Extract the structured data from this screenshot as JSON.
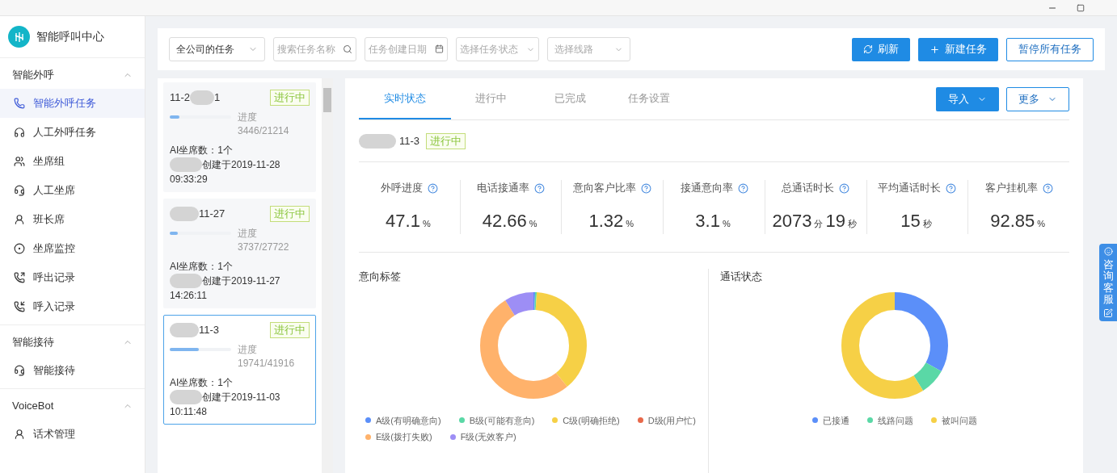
{
  "app": {
    "title": "智能呼叫中心"
  },
  "sidebar": {
    "groups": [
      {
        "label": "智能外呼",
        "expanded": true,
        "items": [
          {
            "label": "智能外呼任务",
            "selected": true
          },
          {
            "label": "人工外呼任务",
            "selected": false
          },
          {
            "label": "坐席组",
            "selected": false
          },
          {
            "label": "人工坐席",
            "selected": false
          },
          {
            "label": "班长席",
            "selected": false
          },
          {
            "label": "坐席监控",
            "selected": false
          },
          {
            "label": "呼出记录",
            "selected": false
          },
          {
            "label": "呼入记录",
            "selected": false
          }
        ]
      },
      {
        "label": "智能接待",
        "expanded": true,
        "items": [
          {
            "label": "智能接待",
            "selected": false
          }
        ]
      },
      {
        "label": "VoiceBot",
        "expanded": true,
        "items": [
          {
            "label": "话术管理",
            "selected": false
          }
        ]
      }
    ]
  },
  "toolbar": {
    "scope": {
      "value": "全公司的任务"
    },
    "search": {
      "placeholder": "搜索任务名称"
    },
    "date": {
      "placeholder": "任务创建日期"
    },
    "status": {
      "placeholder": "选择任务状态"
    },
    "line": {
      "placeholder": "选择线路"
    },
    "buttons": [
      {
        "label": "刷新",
        "kind": "refresh"
      },
      {
        "label": "新建任务",
        "kind": "add"
      },
      {
        "label": "暂停所有任务",
        "kind": "outline"
      }
    ]
  },
  "tasks": [
    {
      "title": "11-2",
      "suffix": "1",
      "status": "进行中",
      "level": 0.16,
      "progress_label": "进度",
      "progress": "3446/21214",
      "agents": "AI坐席数：1个",
      "created": "创建于2019-11-28",
      "time": "09:33:29",
      "selected": false
    },
    {
      "title": "11-27",
      "status": "进行中",
      "level": 0.13,
      "progress_label": "进度",
      "progress": "3737/27722",
      "agents": "AI坐席数：1个",
      "created": "创建于2019-11-27",
      "time": "14:26:11",
      "selected": false
    },
    {
      "title": "11-3",
      "status": "进行中",
      "level": 0.47,
      "progress_label": "进度",
      "progress": "19741/41916",
      "agents": "AI坐席数：1个",
      "created": "创建于2019-11-03",
      "time": "10:11:48",
      "selected": true
    }
  ],
  "detail": {
    "tabs": [
      {
        "label": "实时状态",
        "selected": true
      },
      {
        "label": "进行中",
        "selected": false
      },
      {
        "label": "已完成",
        "selected": false
      },
      {
        "label": "任务设置",
        "selected": false
      }
    ],
    "actions": [
      {
        "label": "导入",
        "kind": "primary"
      },
      {
        "label": "更多",
        "kind": "outline"
      }
    ],
    "task_title": "11-3",
    "task_status": "进行中",
    "stats": [
      {
        "label": "外呼进度",
        "parts": [
          {
            "text": "47.1",
            "kind": "number"
          },
          {
            "text": "%",
            "kind": "unit"
          }
        ]
      },
      {
        "label": "电话接通率",
        "parts": [
          {
            "text": "42.66",
            "kind": "number"
          },
          {
            "text": "%",
            "kind": "unit"
          }
        ]
      },
      {
        "label": "意向客户比率",
        "parts": [
          {
            "text": "1.32",
            "kind": "number"
          },
          {
            "text": "%",
            "kind": "unit"
          }
        ]
      },
      {
        "label": "接通意向率",
        "parts": [
          {
            "text": "3.1",
            "kind": "number"
          },
          {
            "text": "%",
            "kind": "unit"
          }
        ]
      },
      {
        "label": "总通话时长",
        "parts": [
          {
            "text": "2073",
            "kind": "number"
          },
          {
            "text": "分",
            "kind": "unit"
          },
          {
            "text": "19",
            "kind": "number"
          },
          {
            "text": "秒",
            "kind": "unit"
          }
        ]
      },
      {
        "label": "平均通话时长",
        "parts": [
          {
            "text": "15",
            "kind": "number"
          },
          {
            "text": "秒",
            "kind": "unit"
          }
        ]
      },
      {
        "label": "客户挂机率",
        "parts": [
          {
            "text": "92.85",
            "kind": "number"
          },
          {
            "text": "%",
            "kind": "unit"
          }
        ]
      }
    ],
    "charts": [
      {
        "title": "意向标签",
        "legend": [
          {
            "label": "A级(有明确意向)",
            "color": "#5b8ff9"
          },
          {
            "label": "B级(可能有意向)",
            "color": "#5ad8a6"
          },
          {
            "label": "C级(明确拒绝)",
            "color": "#f6d046"
          },
          {
            "label": "D级(用户忙)",
            "color": "#e8684a"
          },
          {
            "label": "E级(拨打失败)",
            "color": "#ffb26b"
          },
          {
            "label": "F级(无效客户)",
            "color": "#9d8ef5"
          }
        ]
      },
      {
        "title": "通话状态",
        "legend": [
          {
            "label": "已接通",
            "color": "#5b8ff9"
          },
          {
            "label": "线路问题",
            "color": "#5ad8a6"
          },
          {
            "label": "被叫问题",
            "color": "#f6d046"
          }
        ]
      }
    ]
  },
  "support_tab": {
    "label": "咨询客服"
  }
}
